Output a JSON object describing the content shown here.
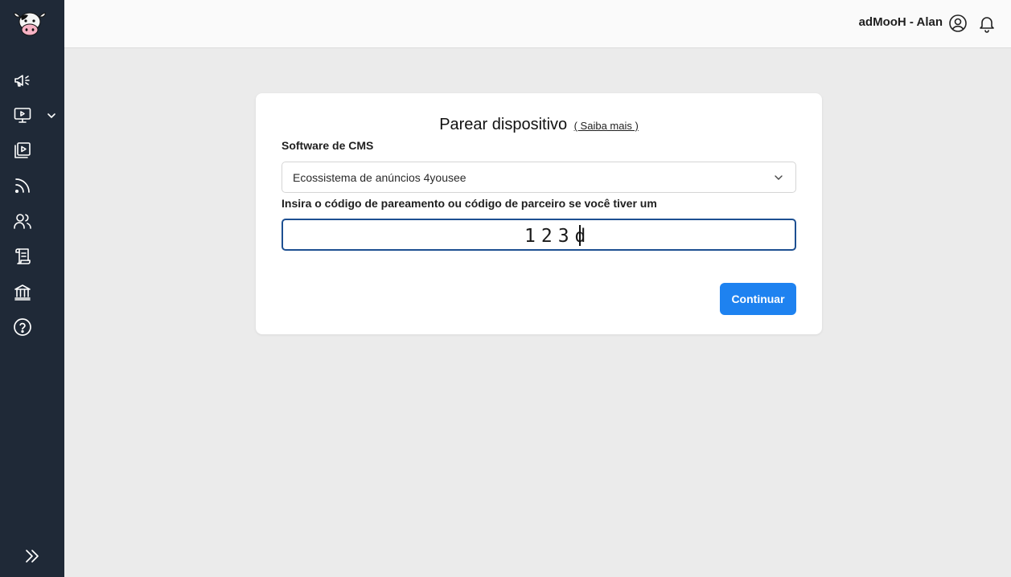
{
  "header": {
    "user_label": "adMooH - Alan",
    "user_icon": "user-circle-icon",
    "notifications_icon": "bell-icon"
  },
  "sidebar": {
    "logo": "cow-logo",
    "items": [
      {
        "icon": "megaphone-icon"
      },
      {
        "icon": "monitor-play-icon",
        "has_submenu": true
      },
      {
        "icon": "media-library-icon"
      },
      {
        "icon": "rss-feed-icon"
      },
      {
        "icon": "users-icon"
      },
      {
        "icon": "scroll-icon"
      },
      {
        "icon": "bank-icon"
      },
      {
        "icon": "help-circle-icon"
      }
    ],
    "collapse_icon": "double-chevron-right-icon"
  },
  "form": {
    "title": "Parear dispositivo",
    "learn_more": "( Saiba mais )",
    "cms_label": "Software de CMS",
    "cms_value": "Ecossistema de anúncios 4yousee",
    "code_label": "Insira o código de pareamento ou código de parceiro se você tiver um",
    "code_value": "123d",
    "submit_label": "Continuar"
  },
  "colors": {
    "sidebar_bg": "#1f2937",
    "page_bg": "#ebebeb",
    "primary_button": "#1e82f0",
    "input_focus_border": "#1d4f91"
  }
}
